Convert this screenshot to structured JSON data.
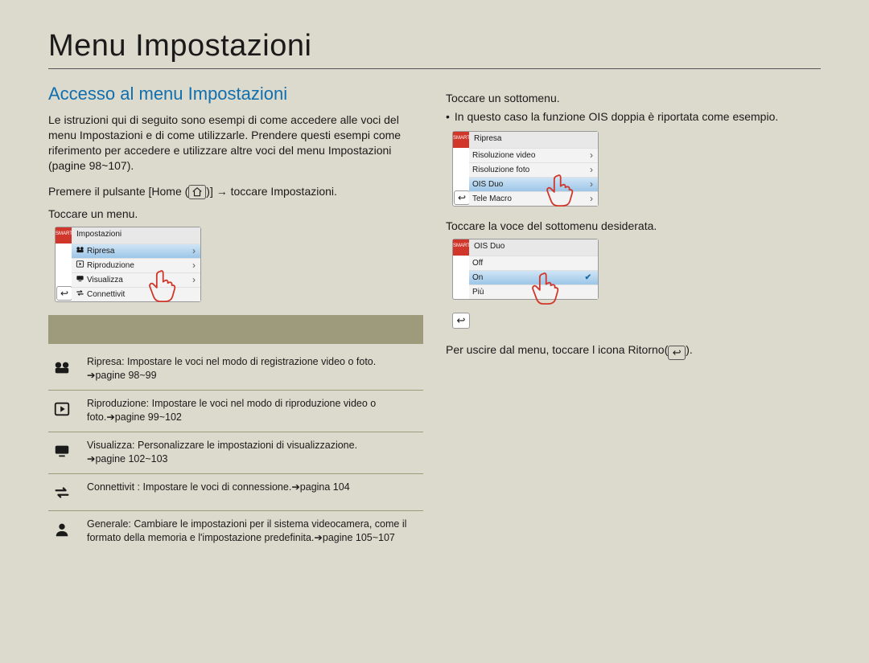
{
  "title": "Menu Impostazioni",
  "section_title": "Accesso al menu Impostazioni",
  "intro": "Le istruzioni qui di seguito sono esempi di come accedere alle voci del menu Impostazioni e di come utilizzarle. Prendere questi esempi come riferimento per accedere e utilizzare altre voci del menu Impostazioni (pagine 98~107).",
  "steps": {
    "press_home_pre": "Premere il pulsante [Home (",
    "press_home_post": ")] → toccare Impostazioni.",
    "touch_menu": "Toccare un menu.",
    "touch_submenu": "Toccare un sottomenu.",
    "ois_note": "In questo caso la funzione OIS doppia è riportata come esempio.",
    "touch_submenu_item": "Toccare la voce del sottomenu desiderata.",
    "exit_pre": "Per uscire dal menu, toccare l icona Ritorno(",
    "exit_post": ")."
  },
  "smart_badge": "SMART",
  "thumbs": {
    "menu": {
      "title": "Impostazioni",
      "rows": [
        {
          "icon": "cam",
          "label": "Ripresa",
          "selected": true,
          "chev": true
        },
        {
          "icon": "play",
          "label": "Riproduzione",
          "selected": false,
          "chev": true
        },
        {
          "icon": "display",
          "label": "Visualizza",
          "selected": false,
          "chev": true
        },
        {
          "icon": "swap",
          "label": "Connettivit",
          "selected": false,
          "chev": false
        }
      ]
    },
    "submenu": {
      "title": "Ripresa",
      "rows": [
        {
          "label": "Risoluzione video",
          "selected": false,
          "chev": true
        },
        {
          "label": "Risoluzione foto",
          "selected": false,
          "chev": true
        },
        {
          "label": "OIS Duo",
          "selected": true,
          "chev": true
        },
        {
          "label": "Tele Macro",
          "selected": false,
          "chev": true
        }
      ]
    },
    "ois": {
      "title": "OIS Duo",
      "rows": [
        {
          "label": "Off",
          "selected": false
        },
        {
          "label": "On",
          "selected": true,
          "check": true
        },
        {
          "label": "Più",
          "selected": false
        }
      ]
    }
  },
  "desc": [
    {
      "icon": "cam",
      "label": "Ripresa:",
      "text": " Impostare le voci nel modo di registrazione video o foto. ",
      "ref": "➔pagine 98~99"
    },
    {
      "icon": "play",
      "label": "Riproduzione:",
      "text": " Impostare le voci nel modo di riproduzione video o foto.",
      "ref": "➔pagine 99~102"
    },
    {
      "icon": "display",
      "label": "Visualizza:",
      "text": " Personalizzare le impostazioni di visualizzazione. ",
      "ref": "➔pagine 102~103"
    },
    {
      "icon": "swap",
      "label": "Connettivit :",
      "text": " Impostare le voci di connessione.",
      "ref": "➔pagina 104"
    },
    {
      "icon": "person",
      "label": "Generale:",
      "text": " Cambiare le impostazioni per il sistema videocamera, come il formato della memoria e l'impostazione predefinita.",
      "ref": "➔pagine 105~107"
    }
  ]
}
